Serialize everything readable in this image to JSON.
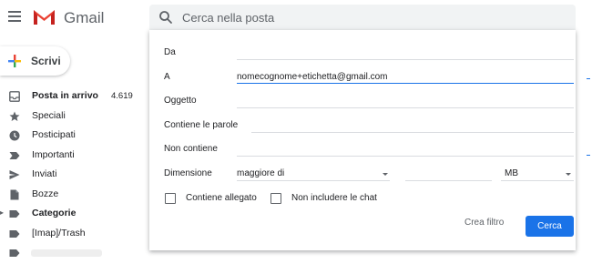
{
  "header": {
    "brand": "Gmail",
    "search_placeholder": "Cerca nella posta",
    "colors": {
      "search_bg": "#f1f3f4",
      "logo_red": "#ea4335"
    }
  },
  "sidebar": {
    "compose_label": "Scrivi",
    "items": [
      {
        "label": "Posta in arrivo",
        "count": "4.619",
        "icon": "inbox-icon",
        "bold": true
      },
      {
        "label": "Speciali",
        "icon": "star-icon"
      },
      {
        "label": "Posticipati",
        "icon": "clock-icon"
      },
      {
        "label": "Importanti",
        "icon": "important-icon"
      },
      {
        "label": "Inviati",
        "icon": "send-icon"
      },
      {
        "label": "Bozze",
        "icon": "draft-icon"
      },
      {
        "label": "Categorie",
        "icon": "label-icon",
        "bold": true
      },
      {
        "label": "[Imap]/Trash",
        "icon": "label-icon"
      }
    ]
  },
  "advanced_search": {
    "from_label": "Da",
    "to_label": "A",
    "to_value": "nomecognome+etichetta@gmail.com",
    "subject_label": "Oggetto",
    "has_words_label": "Contiene le parole",
    "not_has_label": "Non contiene",
    "size_label": "Dimensione",
    "size_operator": "maggiore di",
    "size_unit": "MB",
    "has_attachment_label": "Contiene allegato",
    "exclude_chats_label": "Non includere le chat",
    "create_filter_label": "Crea filtro",
    "search_button_label": "Cerca",
    "colors": {
      "primary": "#1a73e8"
    }
  }
}
